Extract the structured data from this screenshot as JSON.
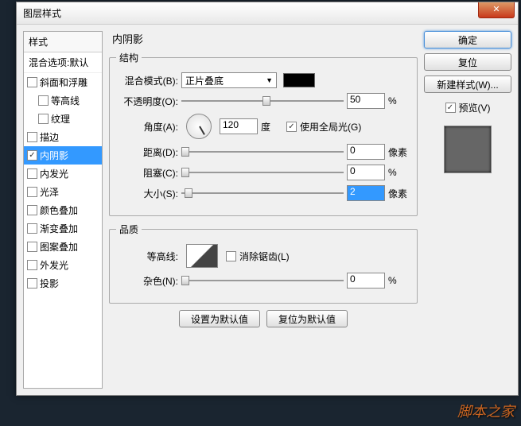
{
  "window": {
    "title": "图层样式"
  },
  "styles": {
    "header": "样式",
    "blendDefault": "混合选项:默认",
    "items": [
      {
        "label": "斜面和浮雕",
        "checked": false,
        "indent": false
      },
      {
        "label": "等高线",
        "checked": false,
        "indent": true
      },
      {
        "label": "纹理",
        "checked": false,
        "indent": true
      },
      {
        "label": "描边",
        "checked": false,
        "indent": false
      },
      {
        "label": "内阴影",
        "checked": true,
        "indent": false,
        "selected": true
      },
      {
        "label": "内发光",
        "checked": false,
        "indent": false
      },
      {
        "label": "光泽",
        "checked": false,
        "indent": false
      },
      {
        "label": "颜色叠加",
        "checked": false,
        "indent": false
      },
      {
        "label": "渐变叠加",
        "checked": false,
        "indent": false
      },
      {
        "label": "图案叠加",
        "checked": false,
        "indent": false
      },
      {
        "label": "外发光",
        "checked": false,
        "indent": false
      },
      {
        "label": "投影",
        "checked": false,
        "indent": false
      }
    ]
  },
  "panel": {
    "title": "内阴影",
    "structure": {
      "legend": "结构",
      "blendMode": {
        "label": "混合模式(B):",
        "value": "正片叠底"
      },
      "opacity": {
        "label": "不透明度(O):",
        "value": "50",
        "unit": "%",
        "pos": 50
      },
      "angle": {
        "label": "角度(A):",
        "value": "120",
        "unit": "度"
      },
      "globalLight": {
        "label": "使用全局光(G)",
        "checked": true
      },
      "distance": {
        "label": "距离(D):",
        "value": "0",
        "unit": "像素",
        "pos": 0
      },
      "choke": {
        "label": "阻塞(C):",
        "value": "0",
        "unit": "%",
        "pos": 0
      },
      "size": {
        "label": "大小(S):",
        "value": "2",
        "unit": "像素",
        "pos": 2
      }
    },
    "quality": {
      "legend": "品质",
      "contour": {
        "label": "等高线:"
      },
      "antiAlias": {
        "label": "消除锯齿(L)",
        "checked": false
      },
      "noise": {
        "label": "杂色(N):",
        "value": "0",
        "unit": "%",
        "pos": 0
      }
    },
    "buttons": {
      "setDefault": "设置为默认值",
      "resetDefault": "复位为默认值"
    }
  },
  "right": {
    "ok": "确定",
    "cancel": "复位",
    "newStyle": "新建样式(W)...",
    "preview": {
      "label": "预览(V)",
      "checked": true
    }
  },
  "watermark": "脚本之家"
}
